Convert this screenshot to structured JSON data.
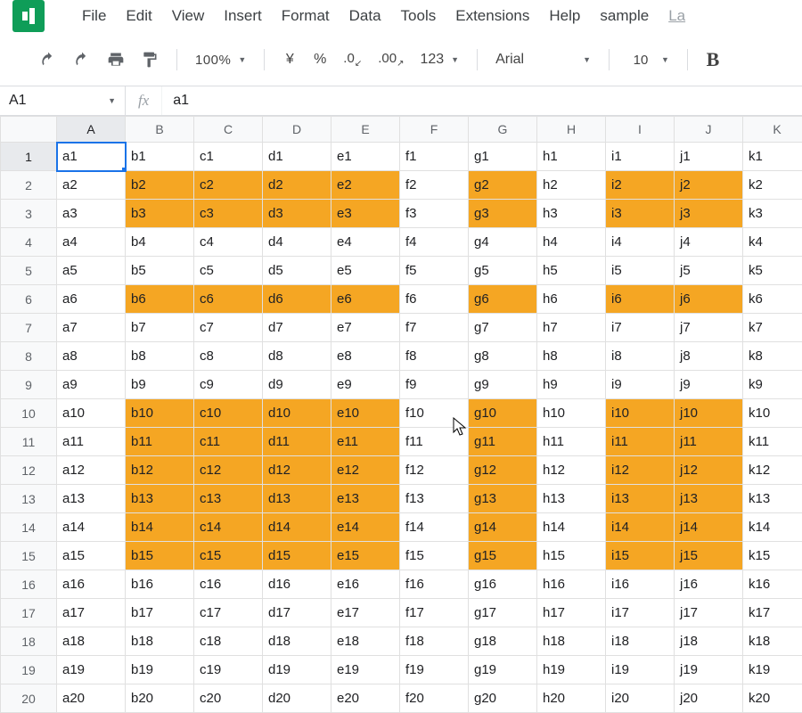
{
  "accent": "#1a73e8",
  "highlight": "#f5a623",
  "menubar": {
    "items": [
      "File",
      "Edit",
      "View",
      "Insert",
      "Format",
      "Data",
      "Tools",
      "Extensions",
      "Help",
      "sample"
    ],
    "last_item": "La"
  },
  "toolbar": {
    "zoom": "100%",
    "currency_symbol": "¥",
    "percent_symbol": "%",
    "dec_decrease": ".0",
    "dec_increase": ".00",
    "number_format": "123",
    "font_name": "Arial",
    "font_size": "10",
    "bold_label": "B"
  },
  "name_box": "A1",
  "fx_label": "fx",
  "formula_value": "a1",
  "columns": [
    "A",
    "B",
    "C",
    "D",
    "E",
    "F",
    "G",
    "H",
    "I",
    "J",
    "K"
  ],
  "rows": [
    1,
    2,
    3,
    4,
    5,
    6,
    7,
    8,
    9,
    10,
    11,
    12,
    13,
    14,
    15,
    16,
    17,
    18,
    19,
    20
  ],
  "col_prefixes": [
    "a",
    "b",
    "c",
    "d",
    "e",
    "f",
    "g",
    "h",
    "i",
    "j",
    "k"
  ],
  "selected_cell": "A1",
  "highlight_columns": [
    "B",
    "C",
    "D",
    "E",
    "G",
    "I",
    "J"
  ],
  "highlight_rows": [
    2,
    3,
    6,
    10,
    11,
    12,
    13,
    14,
    15
  ],
  "chart_data": {
    "type": "table",
    "columns": [
      "A",
      "B",
      "C",
      "D",
      "E",
      "F",
      "G",
      "H",
      "I",
      "J",
      "K"
    ],
    "n_rows": 20,
    "note": "cell value at row r column c is lowercase(column_letter)+r, e.g. B7 -> b7"
  }
}
